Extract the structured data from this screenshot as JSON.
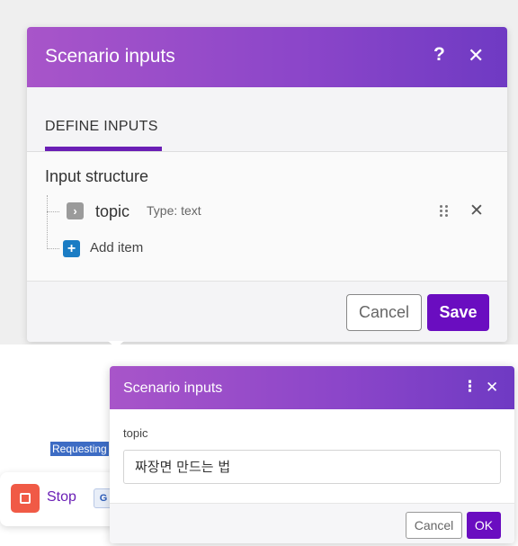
{
  "scenario_modal": {
    "title": "Scenario inputs",
    "help_icon": "?",
    "close_icon": "✕",
    "tab_label": "DEFINE INPUTS",
    "structure_label": "Input structure",
    "fields": [
      {
        "name": "topic",
        "type": "Type: text"
      }
    ],
    "add_item_label": "Add item",
    "cancel_label": "Cancel",
    "save_label": "Save"
  },
  "run_panel": {
    "requesting_text": "Requesting",
    "stop_label": "Stop",
    "translate_icon": "G"
  },
  "run_dialog": {
    "title": "Scenario inputs",
    "more_icon": "⋮",
    "close_icon": "✕",
    "field_label": "topic",
    "field_value": "짜장면 만드는 법",
    "cancel_label": "Cancel",
    "ok_label": "OK"
  },
  "colors": {
    "header_gradient_start": "#a855c9",
    "header_gradient_end": "#6f3ac3",
    "primary_button": "#6a0dc0",
    "stop_button": "#f05a46",
    "add_item_icon": "#1a7cc4"
  },
  "icons": {
    "help": "help-icon",
    "close": "close-icon",
    "expand": "chevron-right-icon",
    "drag": "drag-handle-icon",
    "add": "plus-icon",
    "more": "more-vertical-icon",
    "stop": "stop-icon",
    "translate": "translate-icon"
  }
}
